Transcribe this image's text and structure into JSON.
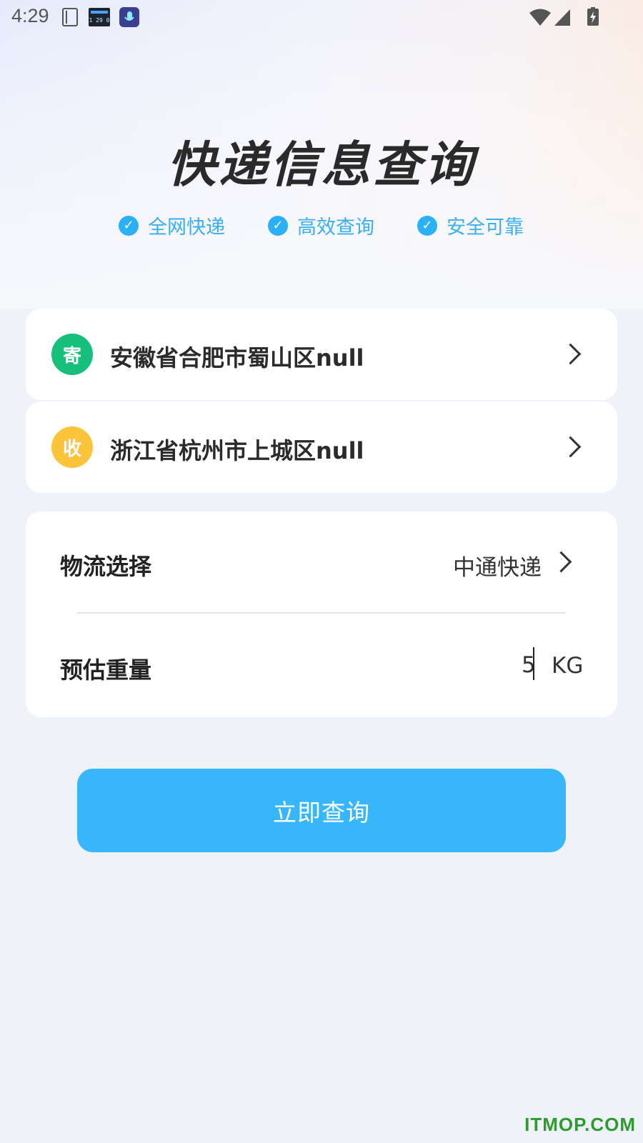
{
  "status_bar": {
    "time": "4:29",
    "notification_icons": [
      "sim-card-icon",
      "clock-widget-icon",
      "microphone-app-icon"
    ],
    "system_icons": [
      "wifi-icon",
      "cellular-signal-icon",
      "battery-charging-icon"
    ]
  },
  "hero": {
    "title": "快递信息查询",
    "features": [
      "全网快递",
      "高效查询",
      "安全可靠"
    ]
  },
  "addresses": [
    {
      "badge": "寄",
      "badge_color": "#17c07a",
      "text": "安徽省合肥市蜀山区null"
    },
    {
      "badge": "收",
      "badge_color": "#fcc43a",
      "text": "浙江省杭州市上城区null"
    }
  ],
  "form": {
    "carrier_label": "物流选择",
    "carrier_value": "中通快递",
    "weight_label": "预估重量",
    "weight_value": "5",
    "weight_unit": "KG"
  },
  "query_button": "立即查询",
  "watermark": "ITMOP.COM",
  "colors": {
    "accent": "#38b6fc",
    "feature_text": "#3aaef0",
    "background": "#eff2f8"
  }
}
